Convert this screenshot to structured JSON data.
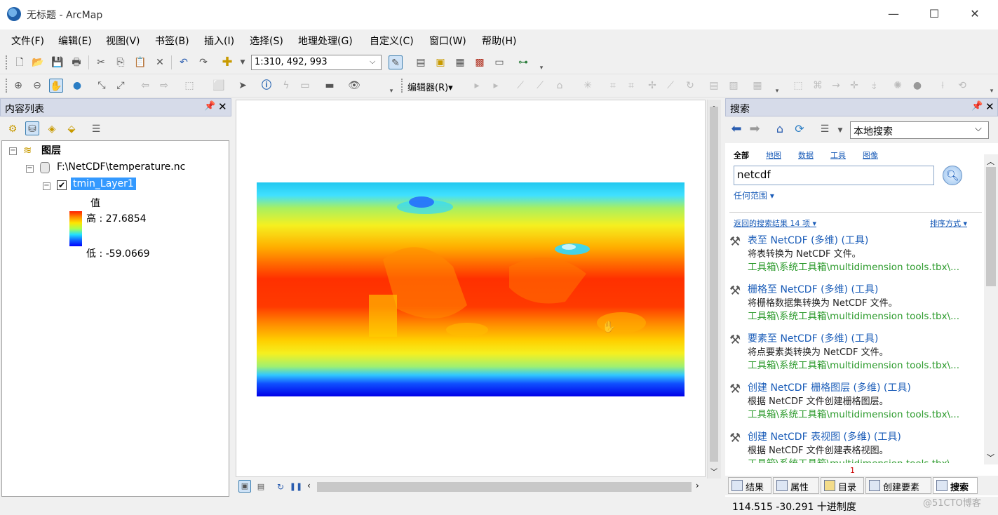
{
  "window": {
    "title": "无标题 - ArcMap",
    "minimize": "—",
    "maximize": "☐",
    "close": "✕"
  },
  "menu": [
    "文件(F)",
    "编辑(E)",
    "视图(V)",
    "书签(B)",
    "插入(I)",
    "选择(S)",
    "地理处理(G)",
    "自定义(C)",
    "窗口(W)",
    "帮助(H)"
  ],
  "toolbar": {
    "scale": "1:310, 492, 993",
    "editor_label": "编辑器(R)▾"
  },
  "toc": {
    "title": "内容列表",
    "layers_root": "图层",
    "source": "F:\\NetCDF\\temperature.nc",
    "layer_name": "tmin_Layer1",
    "legend_title": "值",
    "legend_high": "高 : 27.6854",
    "legend_low": "低 : -59.0669"
  },
  "search": {
    "title": "搜索",
    "scope": "本地搜索",
    "categories": [
      "全部",
      "地图",
      "数据",
      "工具",
      "图像"
    ],
    "query": "netcdf",
    "extent_link": "任何范围 ▾",
    "results_count": "返回的搜索结果 14 项 ▾",
    "sort_label": "排序方式 ▾",
    "results": [
      {
        "title": "表至 NetCDF (多维) (工具)",
        "desc": "将表转换为 NetCDF 文件。",
        "path": "工具箱\\系统工具箱\\multidimension tools.tbx\\..."
      },
      {
        "title": "栅格至 NetCDF (多维) (工具)",
        "desc": "将栅格数据集转换为 NetCDF 文件。",
        "path": "工具箱\\系统工具箱\\multidimension tools.tbx\\..."
      },
      {
        "title": "要素至 NetCDF (多维) (工具)",
        "desc": "将点要素类转换为 NetCDF 文件。",
        "path": "工具箱\\系统工具箱\\multidimension tools.tbx\\..."
      },
      {
        "title": "创建 NetCDF 栅格图层 (多维) (工具)",
        "desc": "根据 NetCDF 文件创建栅格图层。",
        "path": "工具箱\\系统工具箱\\multidimension tools.tbx\\..."
      },
      {
        "title": "创建 NetCDF 表视图 (多维) (工具)",
        "desc": "根据 NetCDF 文件创建表格视图。",
        "path": "工具箱\\系统工具箱\\multidimension tools.tbx\\..."
      }
    ],
    "tabs": [
      "结果",
      "属性",
      "目录",
      "创建要素",
      "搜索"
    ],
    "tab_badge": "1"
  },
  "status": {
    "coords": "114.515   -30.291 十进制度",
    "watermark": "@51CTO博客"
  },
  "colors": {
    "selection": "#3399ff",
    "link": "#1a5cb8",
    "path_green": "#2b9a2b",
    "panel_header": "#d6dbe9"
  }
}
